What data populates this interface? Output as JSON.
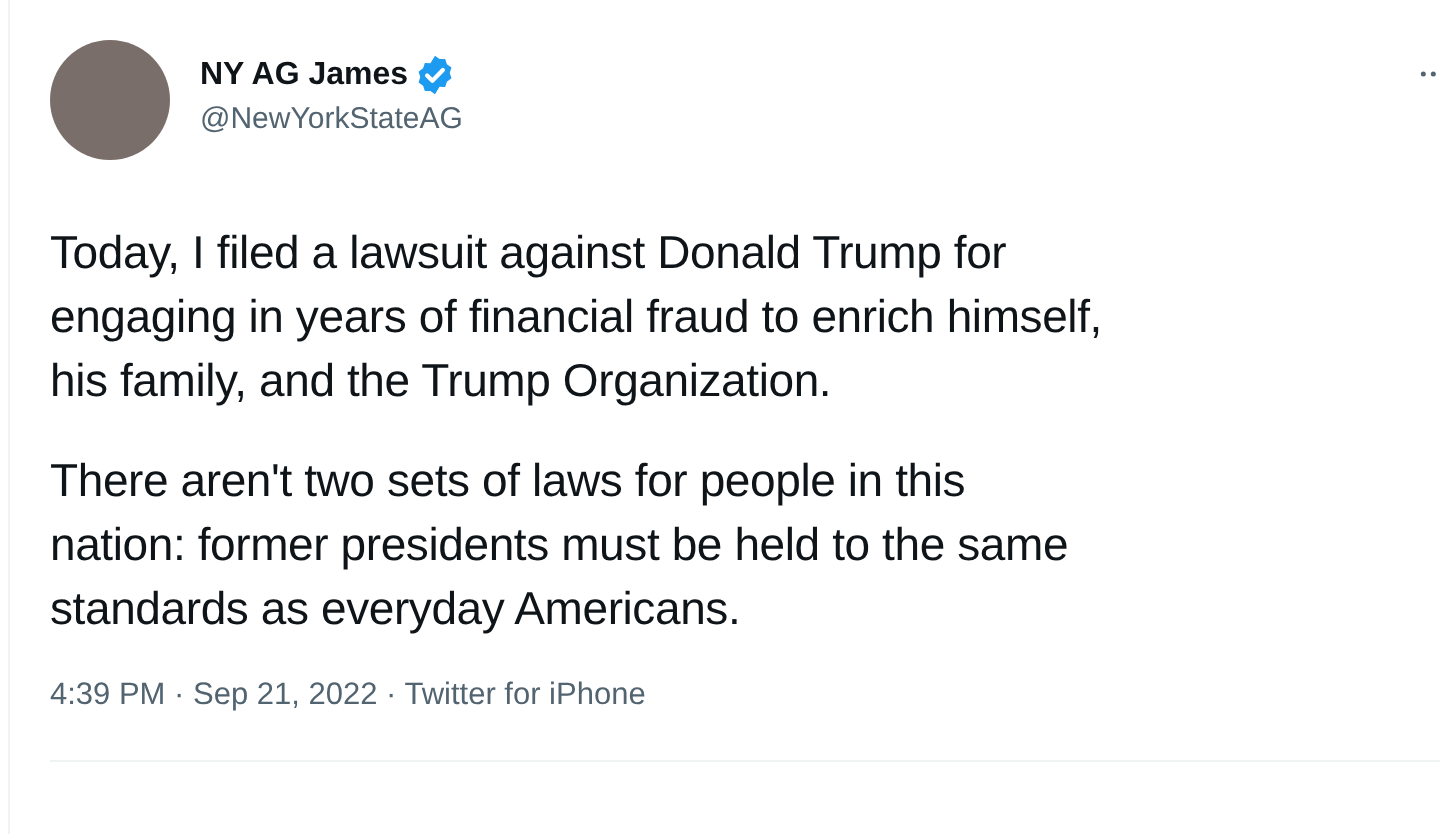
{
  "tweet": {
    "author": {
      "name": "NY AG James",
      "verified": true,
      "handle": "@NewYorkStateAG"
    },
    "paragraphs": [
      "Today, I filed a lawsuit against Donald Trump for\nengaging in years of financial fraud to enrich himself,\nhis family, and the Trump Organization.",
      "There aren't two sets of laws for people in this\nnation: former presidents must be held to the same\nstandards as everyday Americans."
    ],
    "meta": "4:39 PM · Sep 21, 2022 · Twitter for iPhone"
  }
}
